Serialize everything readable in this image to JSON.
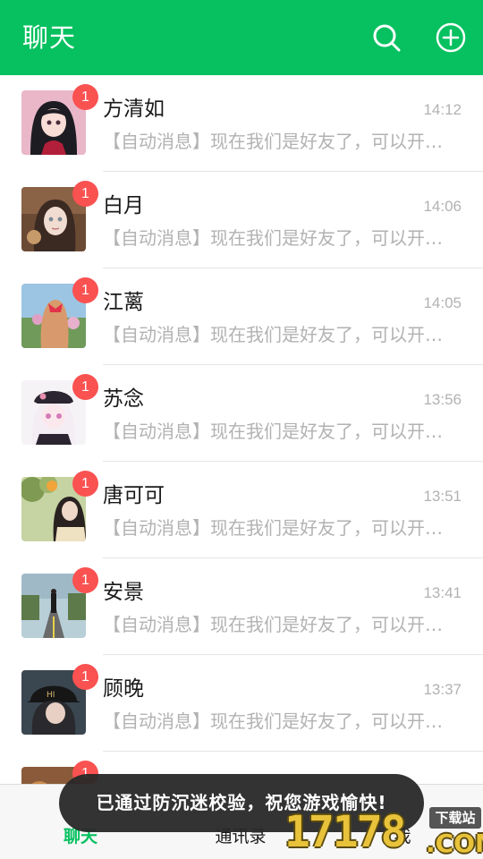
{
  "header": {
    "title": "聊天",
    "search_icon": "search-icon",
    "add_icon": "plus-circle-icon"
  },
  "colors": {
    "brand_green": "#07c160",
    "badge_red": "#fa5151",
    "toast_bg": "#282828"
  },
  "chats": [
    {
      "name": "方清如",
      "time": "14:12",
      "message": "【自动消息】现在我们是好友了，可以开始聊天了",
      "badge": "1"
    },
    {
      "name": "白月",
      "time": "14:06",
      "message": "【自动消息】现在我们是好友了，可以开始聊天了",
      "badge": "1"
    },
    {
      "name": "江蓠",
      "time": "14:05",
      "message": "【自动消息】现在我们是好友了，可以开始聊天了",
      "badge": "1"
    },
    {
      "name": "苏念",
      "time": "13:56",
      "message": "【自动消息】现在我们是好友了，可以开始聊天了",
      "badge": "1"
    },
    {
      "name": "唐可可",
      "time": "13:51",
      "message": "【自动消息】现在我们是好友了，可以开始聊天了",
      "badge": "1"
    },
    {
      "name": "安景",
      "time": "13:41",
      "message": "【自动消息】现在我们是好友了，可以开始聊天了",
      "badge": "1"
    },
    {
      "name": "顾晚",
      "time": "13:37",
      "message": "【自动消息】现在我们是好友了，可以开始聊天了",
      "badge": "1"
    },
    {
      "name": "",
      "time": "",
      "message": "",
      "badge": "1"
    }
  ],
  "tabs": {
    "chats": "聊天",
    "contacts": "通讯录",
    "me": "我"
  },
  "toast": "已通过防沉迷校验，祝您游戏愉快!",
  "watermark": {
    "digits": "17178",
    "suffix": ".COM",
    "tag": "下载站"
  }
}
